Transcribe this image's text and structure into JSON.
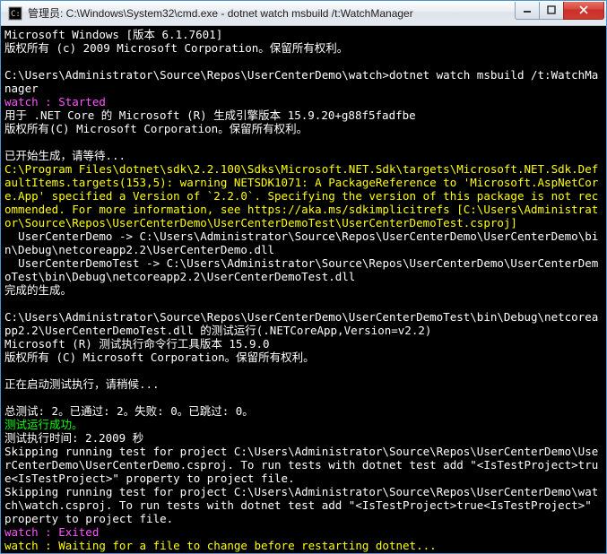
{
  "window": {
    "title": "管理员: C:\\Windows\\System32\\cmd.exe - dotnet  watch msbuild /t:WatchManager"
  },
  "lines": [
    {
      "cls": "cwhite",
      "text": "Microsoft Windows [版本 6.1.7601]"
    },
    {
      "cls": "cwhite",
      "text": "版权所有 (c) 2009 Microsoft Corporation。保留所有权利。"
    },
    {
      "cls": "cwhite",
      "text": ""
    },
    {
      "cls": "cwhite",
      "text": "C:\\Users\\Administrator\\Source\\Repos\\UserCenterDemo\\watch>dotnet watch msbuild /t:WatchManager"
    },
    {
      "cls": "cmagenta",
      "text": "watch : Started"
    },
    {
      "cls": "cwhite",
      "text": "用于 .NET Core 的 Microsoft (R) 生成引擎版本 15.9.20+g88f5fadfbe"
    },
    {
      "cls": "cwhite",
      "text": "版权所有(C) Microsoft Corporation。保留所有权利。"
    },
    {
      "cls": "cwhite",
      "text": ""
    },
    {
      "cls": "cwhite",
      "text": "已开始生成，请等待..."
    },
    {
      "cls": "cyellow",
      "text": "C:\\Program Files\\dotnet\\sdk\\2.2.100\\Sdks\\Microsoft.NET.Sdk\\targets\\Microsoft.NET.Sdk.DefaultItems.targets(153,5): warning NETSDK1071: A PackageReference to 'Microsoft.AspNetCore.App' specified a Version of `2.2.0`. Specifying the version of this package is not recommended. For more information, see https://aka.ms/sdkimplicitrefs [C:\\Users\\Administrator\\Source\\Repos\\UserCenterDemo\\UserCenterDemoTest\\UserCenterDemoTest.csproj]"
    },
    {
      "cls": "cwhite",
      "text": "  UserCenterDemo -> C:\\Users\\Administrator\\Source\\Repos\\UserCenterDemo\\UserCenterDemo\\bin\\Debug\\netcoreapp2.2\\UserCenterDemo.dll"
    },
    {
      "cls": "cwhite",
      "text": "  UserCenterDemoTest -> C:\\Users\\Administrator\\Source\\Repos\\UserCenterDemo\\UserCenterDemoTest\\bin\\Debug\\netcoreapp2.2\\UserCenterDemoTest.dll"
    },
    {
      "cls": "cwhite",
      "text": "完成的生成。"
    },
    {
      "cls": "cwhite",
      "text": ""
    },
    {
      "cls": "cwhite",
      "text": "C:\\Users\\Administrator\\Source\\Repos\\UserCenterDemo\\UserCenterDemoTest\\bin\\Debug\\netcoreapp2.2\\UserCenterDemoTest.dll 的测试运行(.NETCoreApp,Version=v2.2)"
    },
    {
      "cls": "cwhite",
      "text": "Microsoft (R) 测试执行命令行工具版本 15.9.0"
    },
    {
      "cls": "cwhite",
      "text": "版权所有 (C) Microsoft Corporation。保留所有权利。"
    },
    {
      "cls": "cwhite",
      "text": ""
    },
    {
      "cls": "cwhite",
      "text": "正在启动测试执行，请稍候..."
    },
    {
      "cls": "cwhite",
      "text": ""
    },
    {
      "cls": "cwhite",
      "text": "总测试: 2。已通过: 2。失败: 0。已跳过: 0。"
    },
    {
      "cls": "cgreen",
      "text": "测试运行成功。"
    },
    {
      "cls": "cwhite",
      "text": "测试执行时间: 2.2009 秒"
    },
    {
      "cls": "cwhite",
      "text": "Skipping running test for project C:\\Users\\Administrator\\Source\\Repos\\UserCenterDemo\\UserCenterDemo\\UserCenterDemo.csproj. To run tests with dotnet test add \"<IsTestProject>true<IsTestProject>\" property to project file."
    },
    {
      "cls": "cwhite",
      "text": "Skipping running test for project C:\\Users\\Administrator\\Source\\Repos\\UserCenterDemo\\watch\\watch.csproj. To run tests with dotnet test add \"<IsTestProject>true<IsTestProject>\" property to project file."
    },
    {
      "cls": "cmagenta",
      "text": "watch : Exited"
    },
    {
      "cls": "cyellow",
      "text": "watch : Waiting for a file to change before restarting dotnet..."
    }
  ]
}
